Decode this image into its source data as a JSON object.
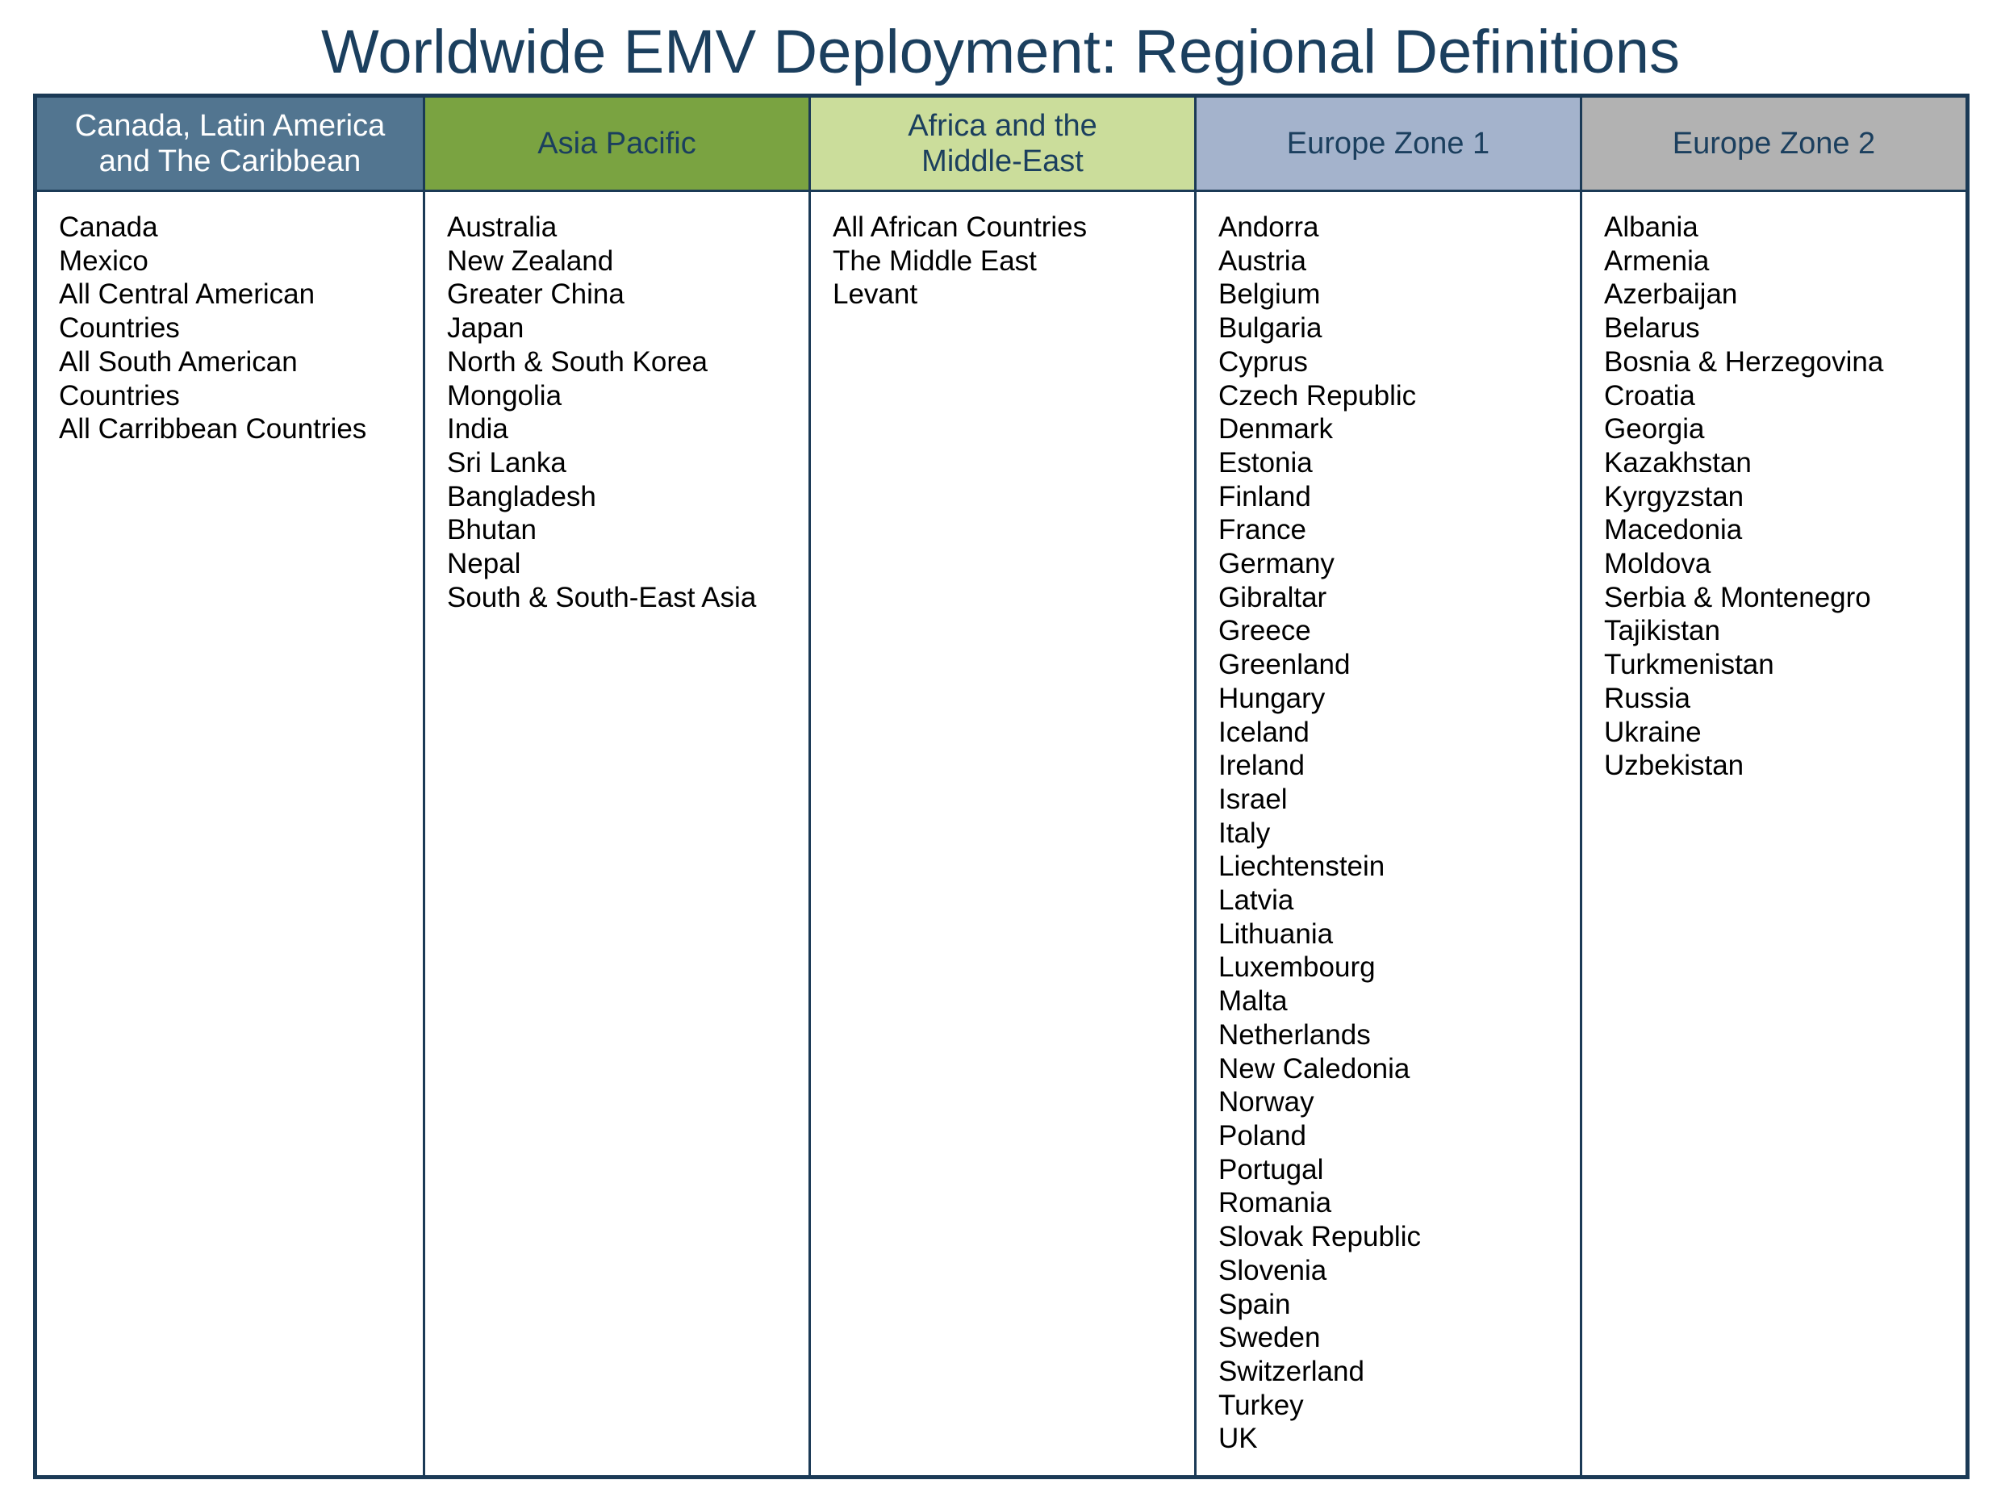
{
  "page": {
    "title": "Worldwide EMV Deployment: Regional Definitions"
  },
  "regions": [
    {
      "header": "Canada, Latin America\nand The Caribbean",
      "header_color": "#527590",
      "countries": [
        "Canada",
        "Mexico",
        "All Central American\nCountries",
        "All South American\nCountries",
        "All Carribbean Countries"
      ]
    },
    {
      "header": "Asia Pacific",
      "header_color": "#7aa341",
      "countries": [
        "Australia",
        "New Zealand",
        "Greater China",
        "Japan",
        "North & South Korea",
        "Mongolia",
        "India",
        "Sri Lanka",
        "Bangladesh",
        "Bhutan",
        "Nepal",
        "South & South-East Asia"
      ]
    },
    {
      "header": "Africa and the\nMiddle-East",
      "header_color": "#cbdd9b",
      "countries": [
        "All African Countries",
        "The Middle East",
        "Levant"
      ]
    },
    {
      "header": "Europe Zone 1",
      "header_color": "#a4b3cc",
      "countries": [
        "Andorra",
        "Austria",
        "Belgium",
        "Bulgaria",
        "Cyprus",
        "Czech Republic",
        "Denmark",
        "Estonia",
        "Finland",
        "France",
        "Germany",
        "Gibraltar",
        "Greece",
        "Greenland",
        "Hungary",
        "Iceland",
        "Ireland",
        "Israel",
        "Italy",
        "Liechtenstein",
        "Latvia",
        "Lithuania",
        "Luxembourg",
        "Malta",
        "Netherlands",
        "New Caledonia",
        "Norway",
        "Poland",
        "Portugal",
        "Romania",
        "Slovak Republic",
        "Slovenia",
        "Spain",
        "Sweden",
        "Switzerland",
        "Turkey",
        "UK"
      ]
    },
    {
      "header": "Europe Zone 2",
      "header_color": "#b2b2b2",
      "countries": [
        "Albania",
        "Armenia",
        "Azerbaijan",
        "Belarus",
        "Bosnia & Herzegovina",
        "Croatia",
        "Georgia",
        "Kazakhstan",
        "Kyrgyzstan",
        "Macedonia",
        "Moldova",
        "Serbia & Montenegro",
        "Tajikistan",
        "Turkmenistan",
        "Russia",
        "Ukraine",
        "Uzbekistan"
      ]
    }
  ]
}
